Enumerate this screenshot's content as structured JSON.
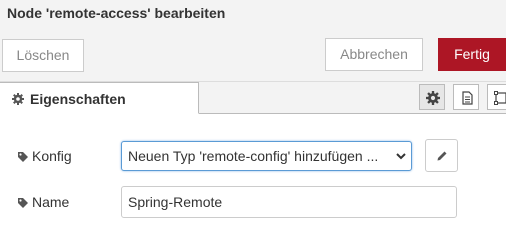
{
  "dialog": {
    "title": "Node 'remote-access' bearbeiten",
    "buttons": {
      "delete_label": "Löschen",
      "cancel_label": "Abbrechen",
      "done_label": "Fertig"
    },
    "accent_color": "#ad1625"
  },
  "tabs": {
    "active_label": "Eigenschaften",
    "icons": [
      "gear-icon",
      "description-icon",
      "appearance-icon"
    ]
  },
  "form": {
    "config": {
      "label": "Konfig",
      "selected_value": "Neuen Typ 'remote-config' hinzufügen ..."
    },
    "name": {
      "label": "Name",
      "value": "Spring-Remote"
    }
  }
}
